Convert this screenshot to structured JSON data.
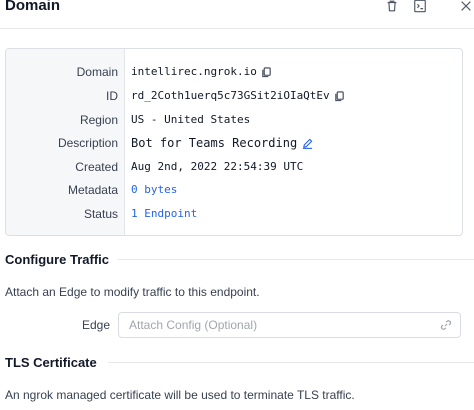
{
  "header": {
    "title": "Domain"
  },
  "details": {
    "rows": [
      {
        "label": "Domain",
        "value": "intellirec.ngrok.io"
      },
      {
        "label": "ID",
        "value": "rd_2Coth1uerq5c73GSit2iOIaQtEv"
      },
      {
        "label": "Region",
        "value": "US - United States"
      },
      {
        "label": "Description",
        "value": "Bot for Teams Recording"
      },
      {
        "label": "Created",
        "value": "Aug 2nd, 2022 22:54:39 UTC"
      },
      {
        "label": "Metadata",
        "value": "0 bytes"
      },
      {
        "label": "Status",
        "value": "1 Endpoint"
      }
    ]
  },
  "configure_traffic": {
    "title": "Configure Traffic",
    "description": "Attach an Edge to modify traffic to this endpoint.",
    "edge_label": "Edge",
    "edge_placeholder": "Attach Config (Optional)",
    "edge_value": ""
  },
  "tls": {
    "title": "TLS Certificate",
    "description": "An ngrok managed certificate will be used to terminate TLS traffic."
  },
  "colors": {
    "link": "#2563eb",
    "label_panel": "#f6f7f9",
    "border": "#dcdfe4"
  },
  "icons": {
    "header": [
      "trash-icon",
      "terminal-icon",
      "close-icon"
    ],
    "copy": "copy-icon",
    "edit": "pencil-icon",
    "link": "link-icon"
  }
}
